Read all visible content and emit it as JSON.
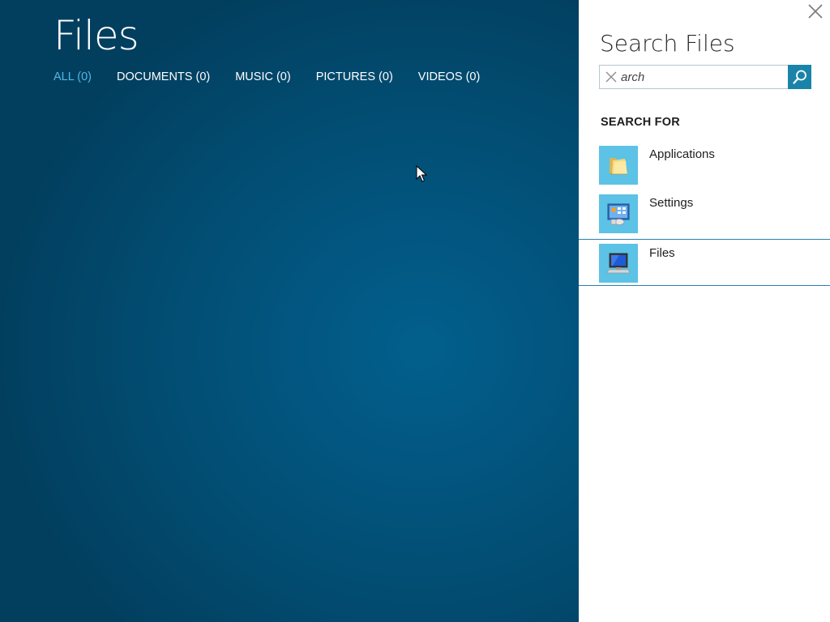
{
  "app": {
    "title": "Files",
    "filters": [
      {
        "label": "ALL (0)",
        "active": true
      },
      {
        "label": "DOCUMENTS (0)",
        "active": false
      },
      {
        "label": "MUSIC (0)",
        "active": false
      },
      {
        "label": "PICTURES (0)",
        "active": false
      },
      {
        "label": "VIDEOS (0)",
        "active": false
      }
    ]
  },
  "search_pane": {
    "title": "Search Files",
    "query": "arch",
    "search_for_heading": "SEARCH FOR",
    "scopes": [
      {
        "label": "Applications",
        "icon": "folder-icon",
        "selected": false
      },
      {
        "label": "Settings",
        "icon": "control-panel-icon",
        "selected": false
      },
      {
        "label": "Files",
        "icon": "computer-icon",
        "selected": true
      }
    ]
  },
  "colors": {
    "background_blue": "#02557f",
    "active_tab": "#4fb8e6",
    "accent": "#1a84a8",
    "tile": "#5cc2e6",
    "selection_border": "#2a7fb0"
  }
}
